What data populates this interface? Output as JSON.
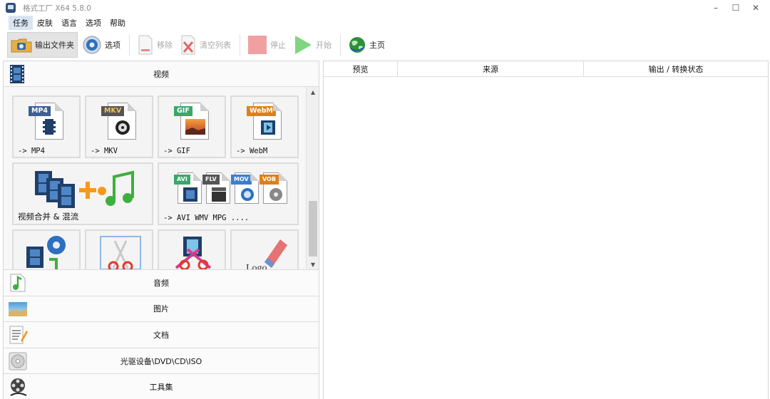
{
  "window": {
    "title": "格式工厂 X64 5.8.0",
    "controls": [
      "–",
      "☐",
      "✕"
    ]
  },
  "menu": [
    "任务",
    "皮肤",
    "语言",
    "选项",
    "帮助"
  ],
  "toolbar": {
    "output_folder": "输出文件夹",
    "options": "选项",
    "remove": "移除",
    "clear_list": "清空列表",
    "stop": "停止",
    "start": "开始",
    "home": "主页"
  },
  "categories": {
    "video": "视频",
    "audio": "音频",
    "image": "图片",
    "document": "文档",
    "disc": "光驱设备\\DVD\\CD\\ISO",
    "tools": "工具集"
  },
  "video_tiles": {
    "mp4": {
      "tag": "MP4",
      "label": "-> MP4"
    },
    "mkv": {
      "tag": "MKV",
      "label": "-> MKV"
    },
    "gif": {
      "tag": "GIF",
      "label": "-> GIF"
    },
    "webm": {
      "tag": "WebM",
      "label": "-> WebM"
    },
    "merge": {
      "label": "视频合并 & 混流"
    },
    "multi": {
      "tags": [
        "AVI",
        "FLV",
        "MOV",
        "VOB"
      ],
      "label": "-> AVI WMV MPG ...."
    },
    "extra_tile_1": {},
    "extra_tile_2": {},
    "extra_tile_3": {},
    "extra_tile_4": {
      "text": "Logo"
    }
  },
  "task_table": {
    "columns": [
      "预览",
      "来源",
      "输出 / 转换状态"
    ]
  },
  "colors": {
    "mp4_tag": "#3c5f95",
    "mkv_tag": "#555555",
    "gif_tag": "#3aa86b",
    "webm_tag": "#e07f1a",
    "stop_icon": "#f0a0a0",
    "start_icon": "#7fd67f"
  }
}
